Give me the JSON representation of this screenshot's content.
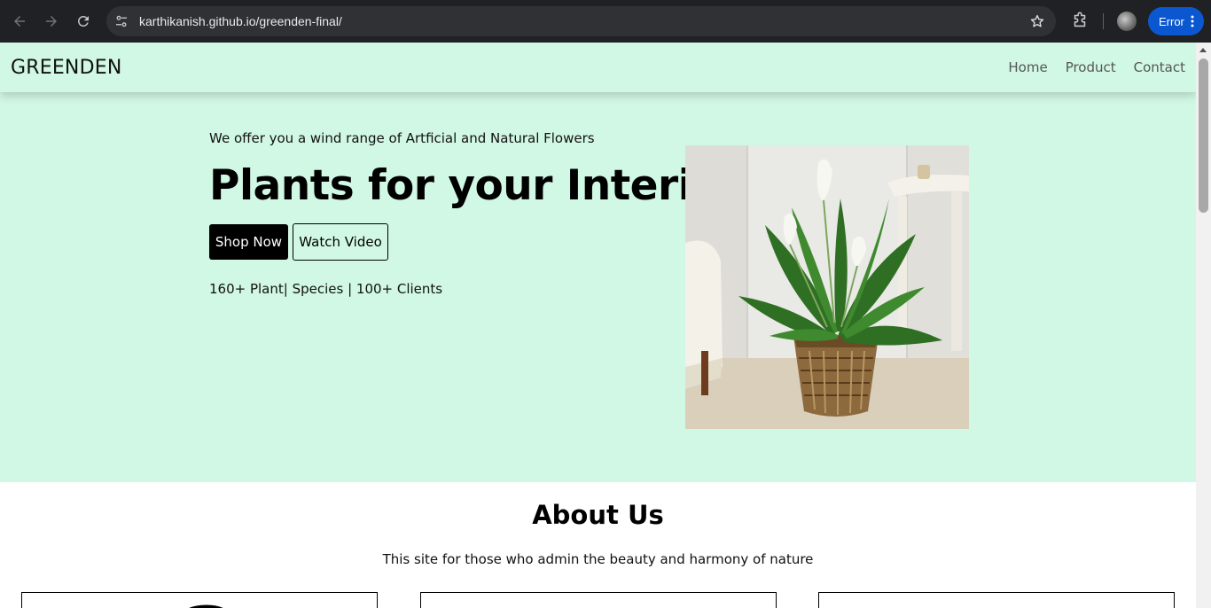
{
  "browser": {
    "url": "karthikanish.github.io/greenden-final/",
    "profile_button_label": "Error",
    "icons": {
      "back": "arrow-left-icon",
      "forward": "arrow-right-icon",
      "reload": "reload-icon",
      "site_info": "tune-icon",
      "bookmark": "star-icon",
      "extensions": "puzzle-icon",
      "menu": "vertical-dots-icon"
    }
  },
  "site": {
    "brand": "GREENDEN",
    "nav": {
      "home": "Home",
      "product": "Product",
      "contact": "Contact"
    },
    "colors": {
      "hero_background": "#d1f8e4",
      "primary_button": "#000000"
    }
  },
  "hero": {
    "tagline": "We offer you a wind range of Artficial and Natural Flowers",
    "title": "Plants for your Interior",
    "shop_button": "Shop Now",
    "video_button": "Watch Video",
    "stats": "160+ Plant| Species | 100+ Clients"
  },
  "about": {
    "title": "About Us",
    "subtitle": "This site for those who admin the beauty and harmony of nature"
  }
}
